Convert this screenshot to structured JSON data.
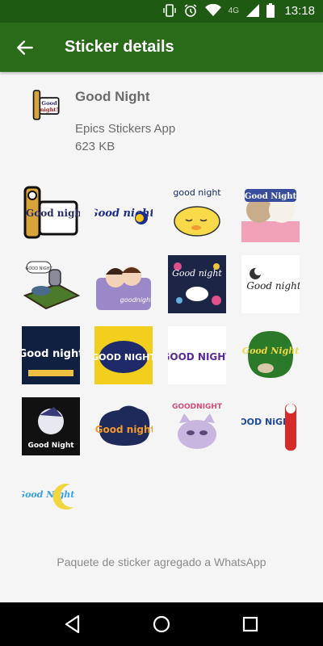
{
  "status_bar": {
    "network": "4G",
    "time": "13:18"
  },
  "app_bar": {
    "title": "Sticker details",
    "back_icon": "arrow-left-icon"
  },
  "pack": {
    "name": "Good Night",
    "publisher": "Epics Stickers App",
    "size": "623 KB"
  },
  "stickers": [
    {
      "text": "Good night!"
    },
    {
      "text": "Good night"
    },
    {
      "text": "good night"
    },
    {
      "text": "Good Night"
    },
    {
      "text": "GOOD NIGHT"
    },
    {
      "text": "goodnight"
    },
    {
      "text": "Good night"
    },
    {
      "text": "Good night"
    },
    {
      "text": "Good night"
    },
    {
      "text": "GOOD NIGHT"
    },
    {
      "text": "GOOD NIGHT"
    },
    {
      "text": "Good Night"
    },
    {
      "text": "Good Night"
    },
    {
      "text": "Good night"
    },
    {
      "text": "GOODNIGHT"
    },
    {
      "text": "GOOD NiGHT"
    },
    {
      "text": "Good Night"
    }
  ],
  "footer_text": "Paquete de sticker agregado a WhatsApp",
  "colors": {
    "status_bar": "#1e5a12",
    "app_bar": "#2a6b1a"
  }
}
